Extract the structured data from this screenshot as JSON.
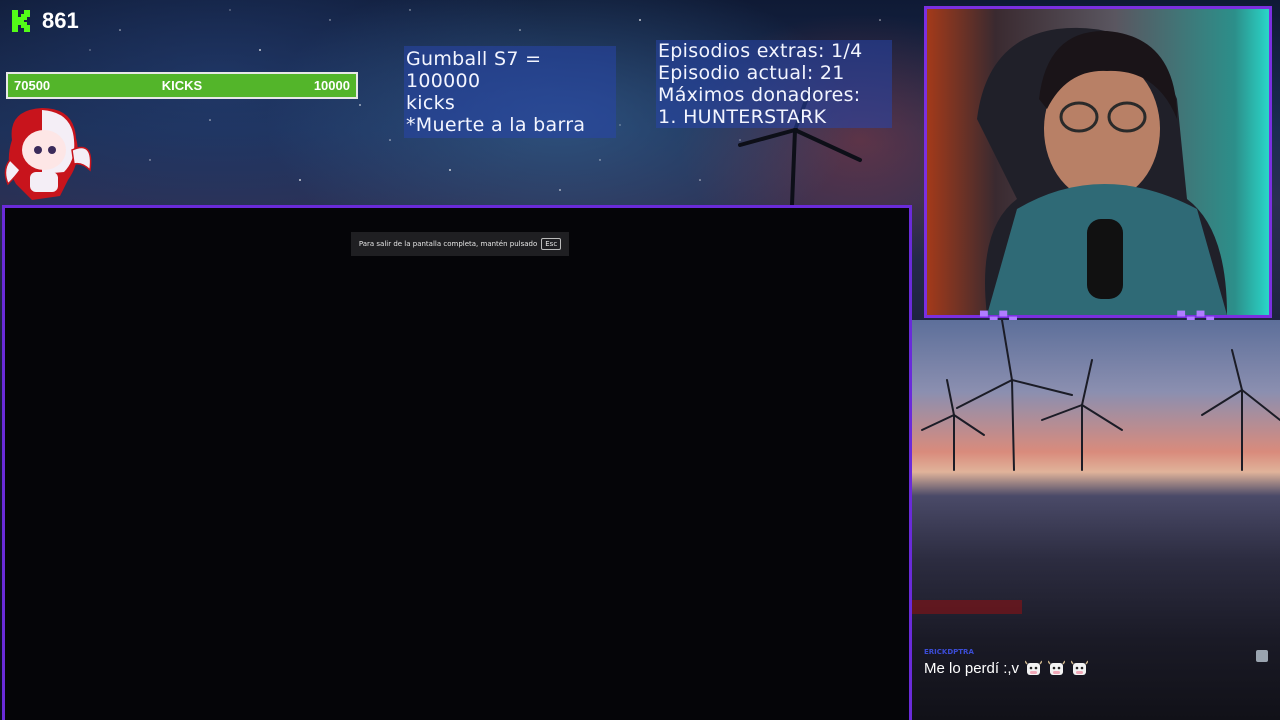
{
  "kick_counter": {
    "count": "861",
    "icon": "kick-logo-icon"
  },
  "goal_bar": {
    "left_value": "70500",
    "label": "KICKS",
    "right_value": "10000"
  },
  "goal_info": {
    "line1": "Gumball S7 = 100000",
    "line2": "kicks",
    "line3": "*Muerte a la barra"
  },
  "episode_info": {
    "line1": "Episodios extras: 1/4",
    "line2": "Episodio actual: 21",
    "line3": "Máximos donadores:",
    "line4": "1. HUNTERSTARK"
  },
  "fullscreen_toast": {
    "text": "Para salir de la pantalla completa, mantén pulsado",
    "key": "Esc"
  },
  "chat": {
    "username": "ERICKDPTRA",
    "message": "Me lo perdí :,v",
    "emotes": [
      "cow-emote-icon",
      "cow-emote-icon",
      "cow-emote-icon"
    ]
  },
  "colors": {
    "frame_accent": "#6a2bd9",
    "goal_green": "#53b52a",
    "kick_green": "#53fc18",
    "info_bg": "#2846aa"
  }
}
